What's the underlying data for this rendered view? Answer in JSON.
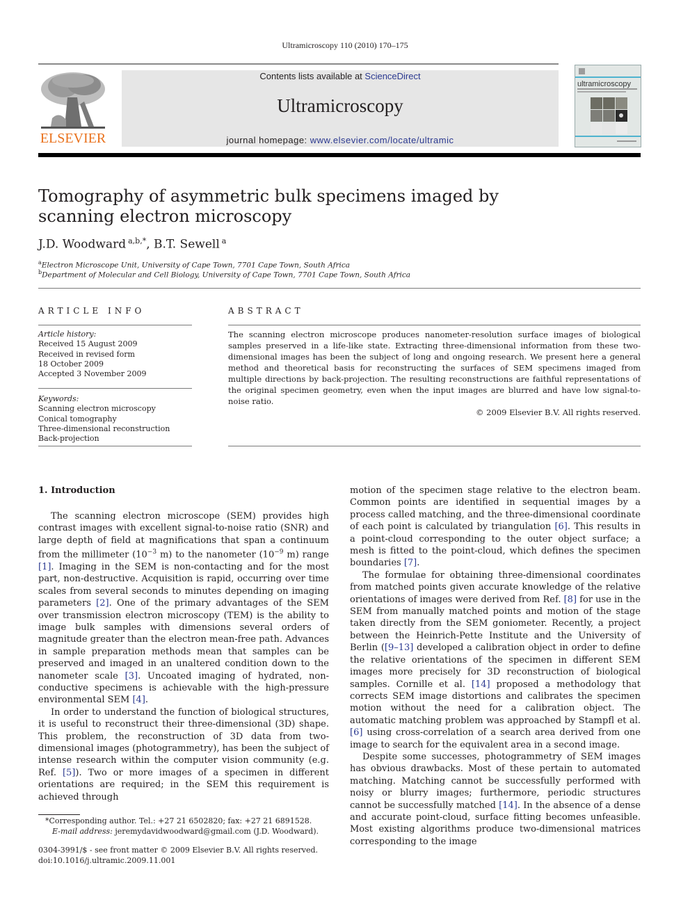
{
  "journal_header": {
    "citation": "Ultramicroscopy 110 (2010) 170–175",
    "publisher_logo_text": "ELSEVIER",
    "contents_prefix": "Contents lists available at ",
    "contents_link": "ScienceDirect",
    "journal_name": "Ultramicroscopy",
    "homepage_prefix": "journal homepage: ",
    "homepage_link": "www.elsevier.com/locate/ultramic",
    "cover_title": "ultramicroscopy",
    "link_color": "#2b3990",
    "logo_color": "#e9711c"
  },
  "article": {
    "title": "Tomography of asymmetric bulk specimens imaged by scanning electron microscopy",
    "authors": [
      {
        "name": "J.D. Woodward",
        "sup": "a,b,*"
      },
      {
        "name": "B.T. Sewell",
        "sup": "a"
      }
    ],
    "author_separator": ", ",
    "affiliations": [
      {
        "mark": "a",
        "text": "Electron Microscope Unit, University of Cape Town, 7701 Cape Town, South Africa"
      },
      {
        "mark": "b",
        "text": "Department of Molecular and Cell Biology, University of Cape Town, 7701 Cape Town, South Africa"
      }
    ]
  },
  "article_info": {
    "heading": "ARTICLE INFO",
    "history_label": "Article history:",
    "history": [
      "Received 15 August 2009",
      "Received in revised form",
      "18 October 2009",
      "Accepted 3 November 2009"
    ],
    "keywords_label": "Keywords:",
    "keywords": [
      "Scanning electron microscopy",
      "Conical tomography",
      "Three-dimensional reconstruction",
      "Back-projection"
    ]
  },
  "abstract": {
    "heading": "ABSTRACT",
    "text": "The scanning electron microscope produces nanometer-resolution surface images of biological samples preserved in a life-like state. Extracting three-dimensional information from these two-dimensional images has been the subject of long and ongoing research. We present here a general method and theoretical basis for reconstructing the surfaces of SEM specimens imaged from multiple directions by back-projection. The resulting reconstructions are faithful representations of the original specimen geometry, even when the input images are blurred and have low signal-to-noise ratio.",
    "copyright": "© 2009 Elsevier B.V. All rights reserved."
  },
  "body": {
    "section_heading": "1.  Introduction",
    "left_paragraphs": [
      {
        "parts": [
          {
            "t": "The scanning electron microscope (SEM) provides high contrast images with excellent signal-to-noise ratio (SNR) and large depth of field at magnifications that span a continuum from the millimeter (10"
          },
          {
            "sup": "−3"
          },
          {
            "t": " m) to the nanometer (10"
          },
          {
            "sup": "−9"
          },
          {
            "t": " m) range "
          },
          {
            "ref": "[1]"
          },
          {
            "t": ". Imaging in the SEM is non-contacting and for the most part, non-destructive. Acquisition is rapid, occurring over time scales from several seconds to minutes depending on imaging parameters "
          },
          {
            "ref": "[2]"
          },
          {
            "t": ". One of the primary advantages of the SEM over transmission electron microscopy (TEM) is the ability to image bulk samples with dimensions several orders of magnitude greater than the electron mean-free path. Advances in sample preparation methods mean that samples can be preserved and imaged in an unaltered condition down to the nanometer scale "
          },
          {
            "ref": "[3]"
          },
          {
            "t": ". Uncoated imaging of hydrated, non-conductive specimens is achievable with the high-pressure environmental SEM "
          },
          {
            "ref": "[4]"
          },
          {
            "t": "."
          }
        ]
      },
      {
        "parts": [
          {
            "t": "In order to understand the function of biological structures, it is useful to reconstruct their three-dimensional (3D) shape. This problem, the reconstruction of 3D data from two-dimensional images (photogrammetry), has been the subject of intense research within the computer vision community (e.g. Ref. "
          },
          {
            "ref": "[5]"
          },
          {
            "t": "). Two or more images of a specimen in different orientations are required; in the SEM this requirement is achieved through"
          }
        ]
      }
    ],
    "right_paragraphs": [
      {
        "continued": true,
        "parts": [
          {
            "t": "motion of the specimen stage relative to the electron beam. Common points are identified in sequential images by a process called matching, and the three-dimensional coordinate of each point is calculated by triangulation "
          },
          {
            "ref": "[6]"
          },
          {
            "t": ". This results in a point-cloud corresponding to the outer object surface; a mesh is fitted to the point-cloud, which defines the specimen boundaries "
          },
          {
            "ref": "[7]"
          },
          {
            "t": "."
          }
        ]
      },
      {
        "parts": [
          {
            "t": "The formulae for obtaining three-dimensional coordinates from matched points given accurate knowledge of the relative orientations of images were derived from Ref. "
          },
          {
            "ref": "[8]"
          },
          {
            "t": " for use in the SEM from manually matched points and motion of the stage taken directly from the SEM goniometer. Recently, a project between the Heinrich-Pette Institute and the University of Berlin ("
          },
          {
            "ref": "[9–13]"
          },
          {
            "t": " developed a calibration object in order to define the relative orientations of the specimen in different SEM images more precisely for 3D reconstruction of biological samples. Cornille et al. "
          },
          {
            "ref": "[14]"
          },
          {
            "t": " proposed a methodology that corrects SEM image distortions and calibrates the specimen motion without the need for a calibration object. The automatic matching problem was approached by Stampfl et al. "
          },
          {
            "ref": "[6]"
          },
          {
            "t": " using cross-correlation of a search area derived from one image to search for the equivalent area in a second image."
          }
        ]
      },
      {
        "parts": [
          {
            "t": "Despite some successes, photogrammetry of SEM images has obvious drawbacks. Most of these pertain to automated matching. Matching cannot be successfully performed with noisy or blurry images; furthermore, periodic structures cannot be successfully matched "
          },
          {
            "ref": "[14]"
          },
          {
            "t": ". In the absence of a dense and accurate point-cloud, surface fitting becomes unfeasible. Most existing algorithms produce two-dimensional matrices corresponding to the image"
          }
        ]
      }
    ]
  },
  "footnote": {
    "corresponding": "*Corresponding author. Tel.: +27 21 6502820; fax: +27 21 6891528.",
    "email_label": "E-mail address:",
    "email": " jeremydavidwoodward@gmail.com (J.D. Woodward)."
  },
  "front_matter": {
    "issn_line": "0304-3991/$ - see front matter © 2009 Elsevier B.V. All rights reserved.",
    "doi": "doi:10.1016/j.ultramic.2009.11.001"
  }
}
